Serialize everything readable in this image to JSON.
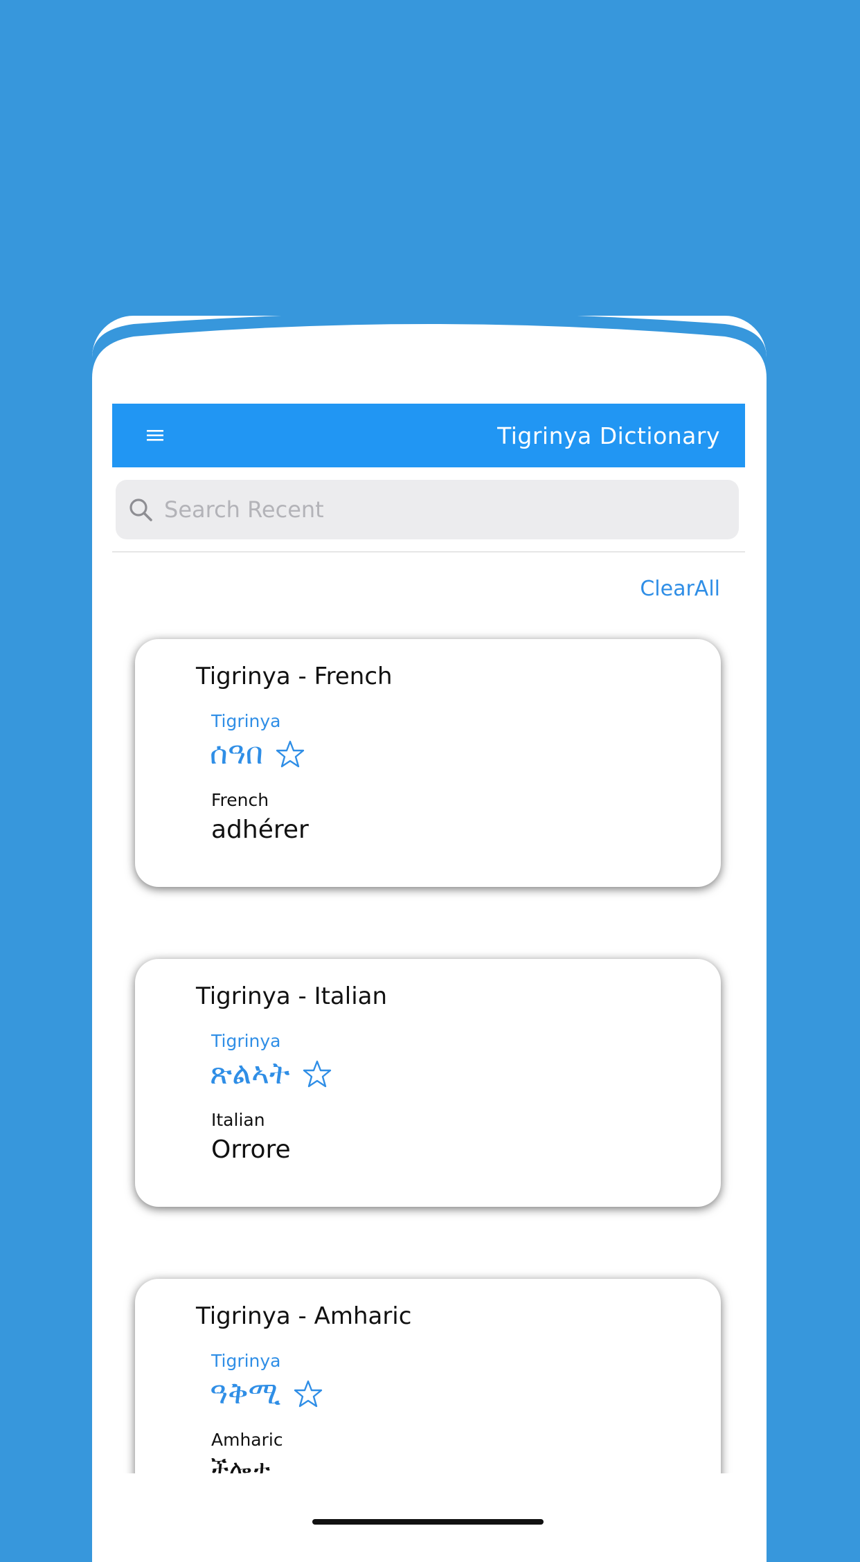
{
  "navbar": {
    "title": "Tigrinya Dictionary",
    "menu_icon": "hamburger-menu-icon"
  },
  "search": {
    "placeholder": "Search Recent",
    "value": "",
    "icon": "search-icon"
  },
  "actions": {
    "clear_all": "ClearAll"
  },
  "cards": [
    {
      "title": "Tigrinya - French",
      "source_language": "Tigrinya",
      "word": "ሰዓበ",
      "target_language": "French",
      "translation": "adhérer"
    },
    {
      "title": "Tigrinya - Italian",
      "source_language": "Tigrinya",
      "word": "ጽልኣት",
      "target_language": "Italian",
      "translation": "Orrore"
    },
    {
      "title": "Tigrinya - Amharic",
      "source_language": "Tigrinya",
      "word": "ዓቅሚ",
      "target_language": "Amharic",
      "translation": "ችሎታ"
    }
  ],
  "colors": {
    "background": "#3797dc",
    "navbar": "#2196f3",
    "accent": "#2f8ee6",
    "card": "#ffffff"
  }
}
